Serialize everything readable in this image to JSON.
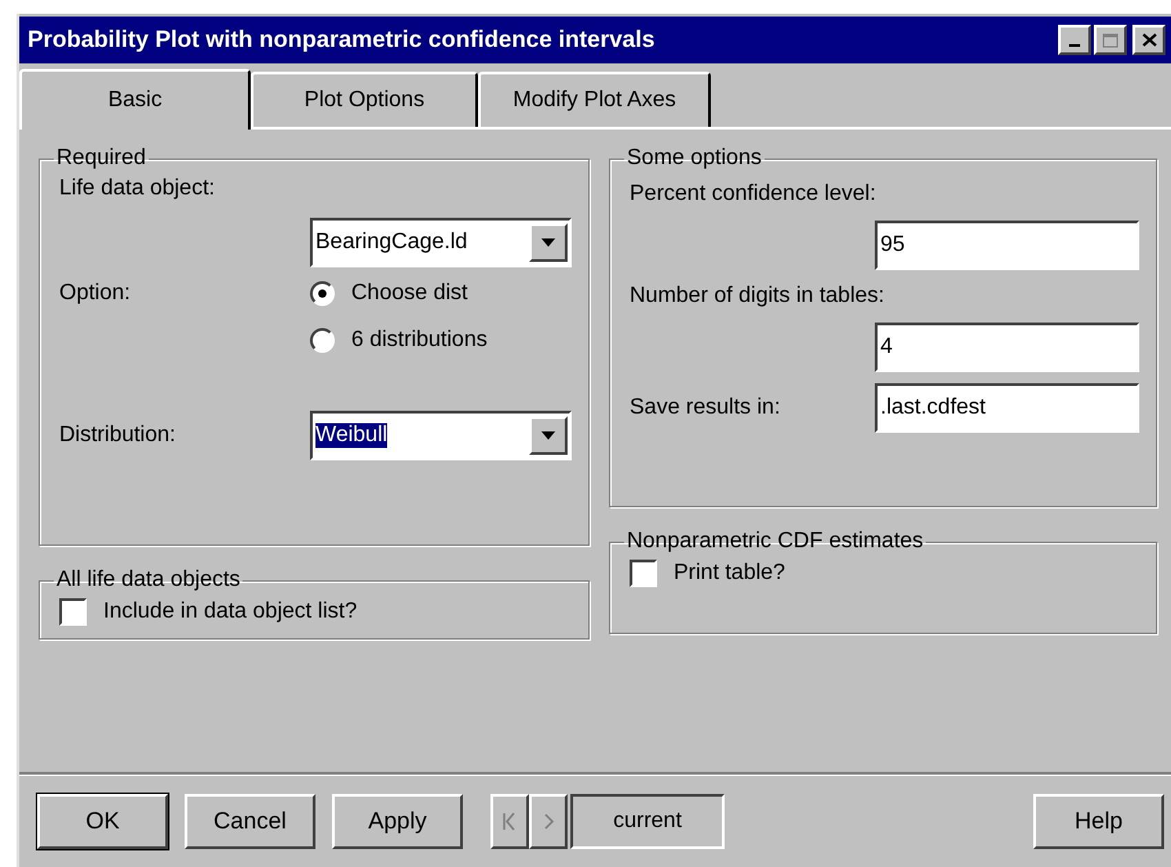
{
  "window": {
    "title": "Probability Plot with nonparametric confidence intervals"
  },
  "tabs": [
    {
      "label": "Basic",
      "selected": true
    },
    {
      "label": "Plot Options",
      "selected": false
    },
    {
      "label": "Modify Plot Axes",
      "selected": false
    }
  ],
  "required": {
    "title": "Required",
    "life_data_label": "Life data object:",
    "life_data_value": "BearingCage.ld",
    "option_label": "Option:",
    "options": [
      {
        "label": "Choose dist",
        "selected": true
      },
      {
        "label": "6 distributions",
        "selected": false
      }
    ],
    "distribution_label": "Distribution:",
    "distribution_value": "Weibull",
    "distribution_highlighted": true
  },
  "all_objects": {
    "title": "All life data objects",
    "checkbox": {
      "label": "Include in data object list?",
      "checked": false
    }
  },
  "some_options": {
    "title": "Some options",
    "fields": [
      {
        "label": "Percent confidence level:",
        "value": "95",
        "kind": "stacked"
      },
      {
        "label": "Number of digits in tables:",
        "value": "4",
        "kind": "stacked"
      },
      {
        "label": "Save results in:",
        "value": ".last.cdfest",
        "kind": "inline"
      }
    ]
  },
  "cdf_estimates": {
    "title": "Nonparametric CDF estimates",
    "checkbox": {
      "label": "Print table?",
      "checked": false
    }
  },
  "buttons": [
    {
      "label": "OK",
      "default": true
    },
    {
      "label": "Cancel",
      "default": false
    },
    {
      "label": "Apply",
      "default": false
    }
  ],
  "navigator": {
    "current": "current"
  },
  "help": {
    "label": "Help"
  }
}
